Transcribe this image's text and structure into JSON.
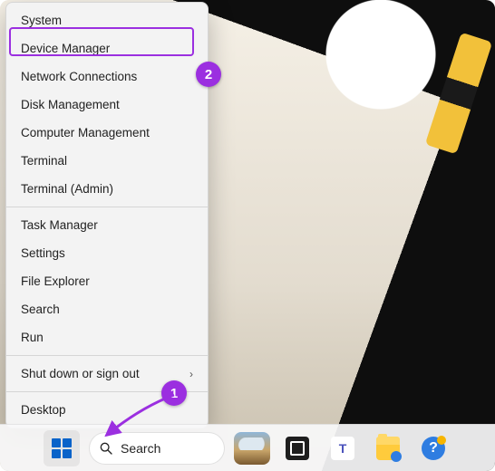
{
  "annotations": {
    "accent_color": "#9b2fe0",
    "badge1": "1",
    "badge2": "2"
  },
  "winx_menu": {
    "groups": [
      {
        "items": [
          {
            "label": "System",
            "submenu": false
          },
          {
            "label": "Device Manager",
            "submenu": false,
            "highlighted": true
          },
          {
            "label": "Network Connections",
            "submenu": false
          },
          {
            "label": "Disk Management",
            "submenu": false
          },
          {
            "label": "Computer Management",
            "submenu": false
          },
          {
            "label": "Terminal",
            "submenu": false
          },
          {
            "label": "Terminal (Admin)",
            "submenu": false
          }
        ]
      },
      {
        "items": [
          {
            "label": "Task Manager",
            "submenu": false
          },
          {
            "label": "Settings",
            "submenu": false
          },
          {
            "label": "File Explorer",
            "submenu": false
          },
          {
            "label": "Search",
            "submenu": false
          },
          {
            "label": "Run",
            "submenu": false
          }
        ]
      },
      {
        "items": [
          {
            "label": "Shut down or sign out",
            "submenu": true
          }
        ]
      },
      {
        "items": [
          {
            "label": "Desktop",
            "submenu": false
          }
        ]
      }
    ]
  },
  "taskbar": {
    "search_label": "Search",
    "icons": {
      "start": "start-icon",
      "search": "search-icon",
      "weather": "weather-widget",
      "taskview": "task-view-icon",
      "teams": "teams-icon",
      "explorer": "file-explorer-icon",
      "help": "get-help-icon"
    }
  }
}
